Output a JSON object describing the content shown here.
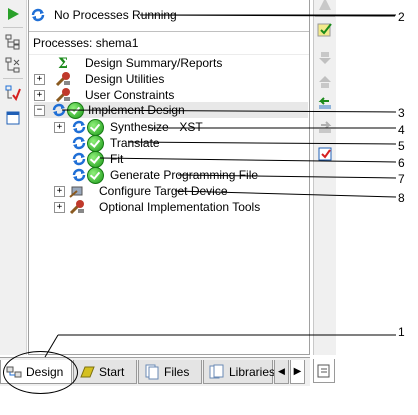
{
  "status": {
    "text": "No Processes Running"
  },
  "processes": {
    "header": "Processes: shema1",
    "items": [
      {
        "label": "Design Summary/Reports"
      },
      {
        "label": "Design Utilities",
        "expander": "+"
      },
      {
        "label": "User Constraints",
        "expander": "+"
      },
      {
        "label": "Implement Design",
        "expander": "−"
      },
      {
        "label": "Synthesize - XST",
        "expander": "+"
      },
      {
        "label": "Translate"
      },
      {
        "label": "Fit"
      },
      {
        "label": "Generate Programming File"
      },
      {
        "label": "Configure Target Device",
        "expander": "+"
      },
      {
        "label": "Optional Implementation Tools",
        "expander": "+"
      }
    ]
  },
  "tabs": [
    {
      "label": "Design"
    },
    {
      "label": "Start"
    },
    {
      "label": "Files"
    },
    {
      "label": "Libraries"
    }
  ],
  "tab_nav": {
    "next": "▶",
    "prev": "◀"
  },
  "callouts": [
    "1",
    "2",
    "3",
    "4",
    "5",
    "6",
    "7",
    "8"
  ],
  "colors": {
    "success": "#1b9a18",
    "refresh": "#1f6fd6",
    "annotation": "#000000"
  }
}
